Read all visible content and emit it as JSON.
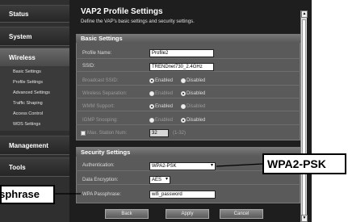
{
  "nav": {
    "status": "Status",
    "system": "System",
    "wireless": "Wireless",
    "sub_items": [
      "Basic Settings",
      "Profile Settings",
      "Advanced Settings",
      "Traffic Shaping",
      "Access Control",
      "WDS Settings"
    ],
    "management": "Management",
    "tools": "Tools"
  },
  "header": {
    "title": "VAP2 Profile Settings",
    "subtitle": "Define the VAP's basic settings and security settings."
  },
  "basic": {
    "heading": "Basic Settings",
    "profile_name_label": "Profile Name:",
    "profile_name_value": "Profile2",
    "ssid_label": "SSID:",
    "ssid_value": "TRENDnet730_2.4GHz",
    "broadcast_label": "Broadcast SSID:",
    "separation_label": "Wireless Separation:",
    "wmm_label": "WMM Support:",
    "igmp_label": "IGMP Snooping:",
    "enabled": "Enabled",
    "disabled": "Disabled",
    "max_station_label": "Max. Station Num:",
    "max_station_value": "32",
    "max_station_range": "(1-32)"
  },
  "security": {
    "heading": "Security Settings",
    "auth_label": "Authentication:",
    "auth_value": "WPA2-PSK",
    "encryption_label": "Data Encryption:",
    "encryption_value": "AES",
    "passphrase_label": "WPA Passphrase:",
    "passphrase_value": "wifi_password"
  },
  "buttons": {
    "back": "Back",
    "apply": "Apply",
    "cancel": "Cancel"
  },
  "callouts": {
    "wpa": "WPA2-PSK",
    "passphrase": "Passphrase"
  }
}
